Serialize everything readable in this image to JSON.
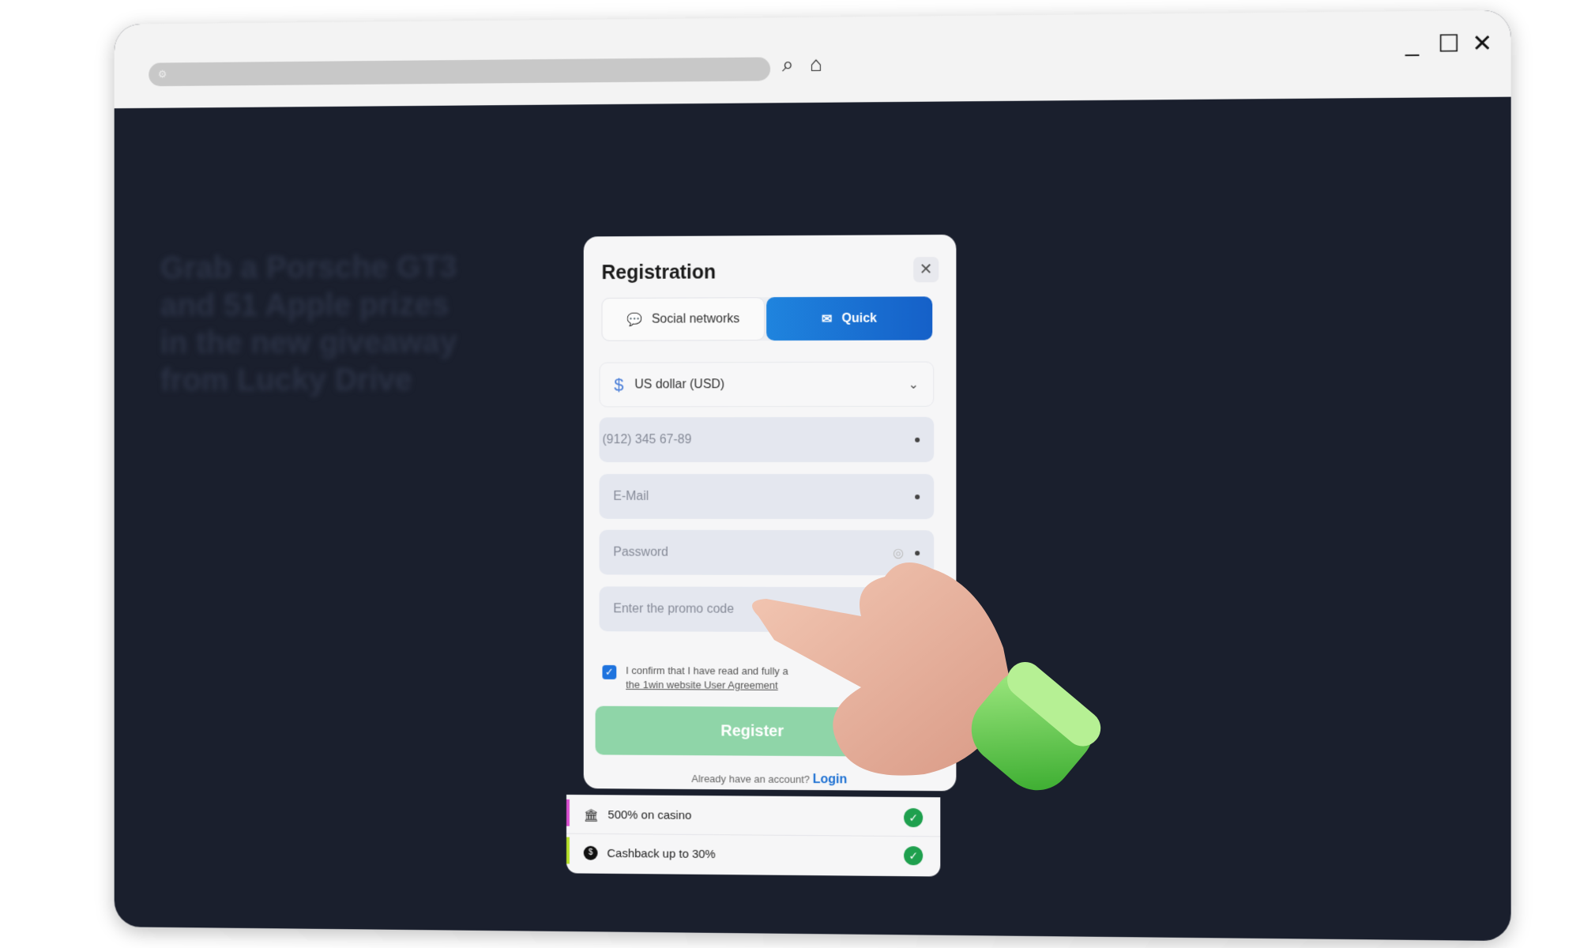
{
  "browser": {
    "icons": [
      "settings-icon",
      "search-icon",
      "home-icon"
    ],
    "controls": [
      "minimize",
      "maximize",
      "close"
    ]
  },
  "background": {
    "headline": "Grab a Porsche GT3 and 51 Apple prizes in the new giveaway from Lucky Drive"
  },
  "modal": {
    "title": "Registration",
    "tabs": [
      {
        "label": "Social networks",
        "icon": "chat-bubbles-icon",
        "active": false
      },
      {
        "label": "Quick",
        "icon": "envelope-icon",
        "active": true
      }
    ],
    "currency": {
      "value": "US dollar (USD)",
      "icon": "dollar-icon"
    },
    "phone": {
      "placeholder": "(912) 345 67-89"
    },
    "email": {
      "placeholder": "E-Mail"
    },
    "password": {
      "placeholder": "Password"
    },
    "promo": {
      "placeholder": "Enter the promo code"
    },
    "agreement": {
      "checked": true,
      "text": "I confirm that I have read and fully a",
      "link": "the 1win website User Agreement"
    },
    "register_label": "Register",
    "have_account": "Already have an account?",
    "login_label": "Login",
    "colors": {
      "accent": "#1f6fd8",
      "register": "#8fd5a8",
      "check": "#1fa04e"
    }
  },
  "bonuses": [
    {
      "label": "500% on casino",
      "icon": "casino-icon",
      "accent": "#d94fd0"
    },
    {
      "label": "Cashback up to 30%",
      "icon": "cashback-icon",
      "accent": "#b6e02a"
    }
  ]
}
